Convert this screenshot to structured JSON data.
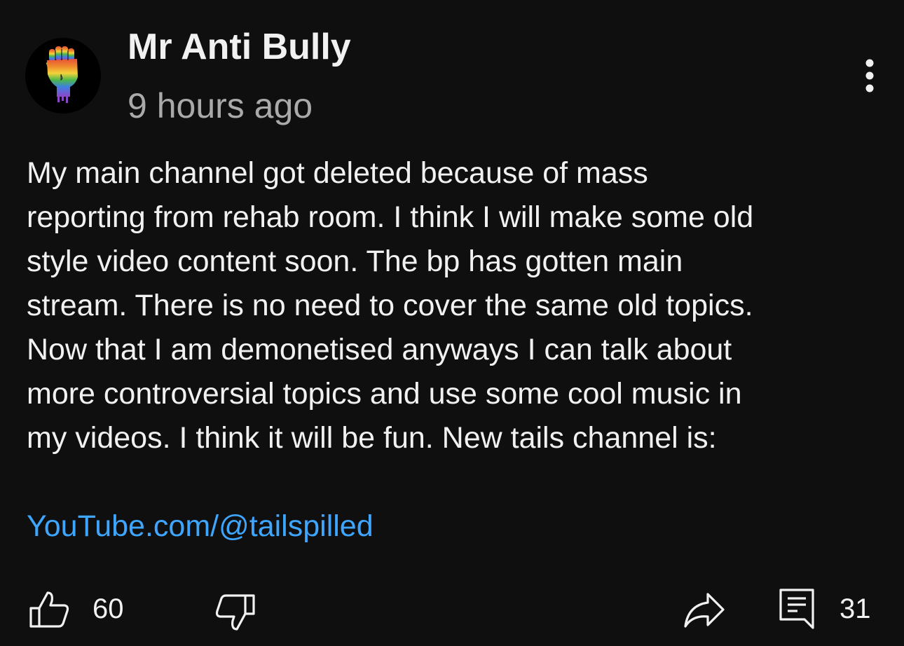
{
  "post": {
    "author": "Mr Anti Bully",
    "timestamp": "9 hours ago",
    "avatar_icon": "rainbow-raised-fist-icon",
    "body_lines": [
      "My main channel got deleted because of mass",
      "reporting from rehab room. I think I will make some old",
      "style video content soon. The bp has gotten main",
      "stream. There is no need to cover the same old topics.",
      "Now that I am demonetised anyways I can talk about",
      "more controversial topics and use some cool music in",
      "my videos. I think it will be fun. New tails channel is:"
    ],
    "link": "YouTube.com/@tailspilled"
  },
  "actions": {
    "like_count": "60",
    "comment_count": "31",
    "like_icon": "thumbs-up-icon",
    "dislike_icon": "thumbs-down-icon",
    "share_icon": "share-arrow-icon",
    "comment_icon": "comment-icon",
    "menu_icon": "vertical-ellipsis-icon"
  },
  "colors": {
    "background": "#0f0f0f",
    "text": "#f1f1f1",
    "secondary_text": "#aaaaaa",
    "link": "#3ea6ff"
  }
}
